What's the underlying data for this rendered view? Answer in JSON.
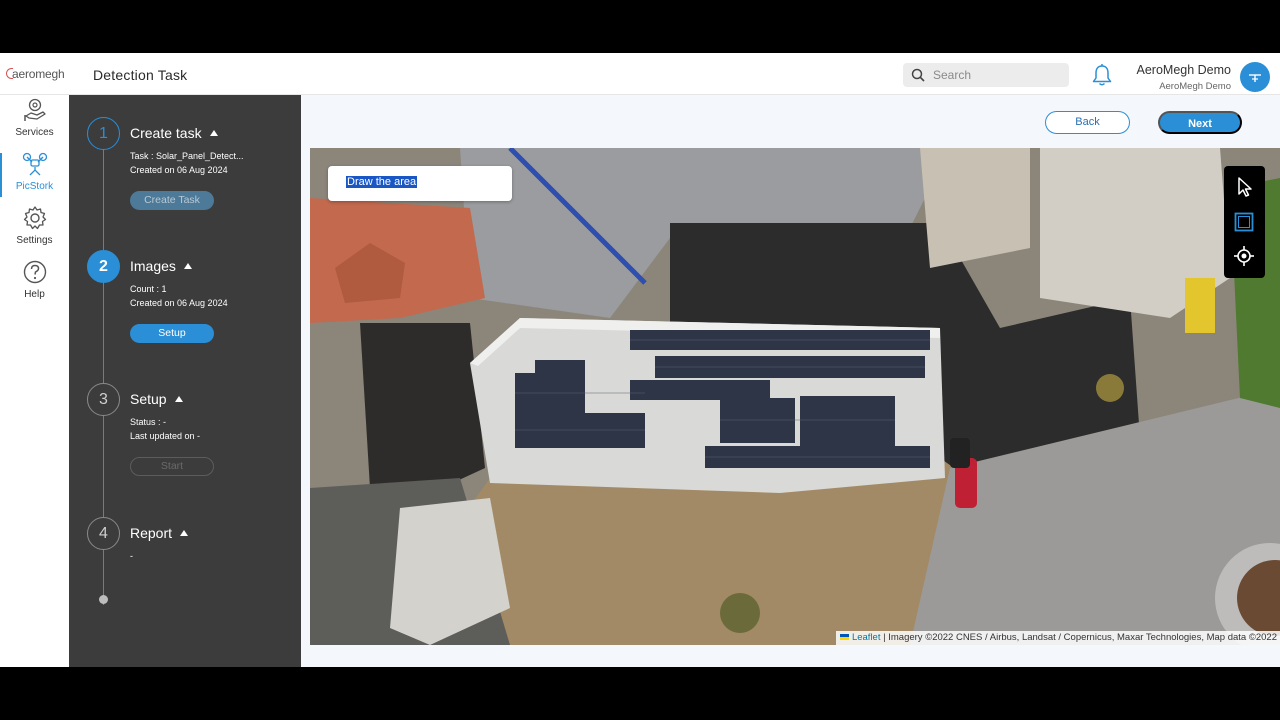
{
  "brand": {
    "logo_text": "aeromegh"
  },
  "header": {
    "title": "Detection Task",
    "search_placeholder": "Search",
    "user_name": "AeroMegh Demo",
    "user_org": "AeroMegh Demo"
  },
  "nav": {
    "items": [
      {
        "label": "Services",
        "icon": "services-icon"
      },
      {
        "label": "PicStork",
        "icon": "drone-icon",
        "active": true
      },
      {
        "label": "Settings",
        "icon": "gear-icon"
      },
      {
        "label": "Help",
        "icon": "help-icon"
      }
    ]
  },
  "steps": [
    {
      "number": "1",
      "title": "Create task",
      "meta1": "Task : Solar_Panel_Detect...",
      "meta2": "Created on 06 Aug 2024",
      "button": "Create Task",
      "state": "done"
    },
    {
      "number": "2",
      "title": "Images",
      "meta1": "Count : 1",
      "meta2": "Created on 06 Aug 2024",
      "button": "Setup",
      "state": "active"
    },
    {
      "number": "3",
      "title": "Setup",
      "meta1": "Status : -",
      "meta2": "Last updated on -",
      "button": "Start",
      "state": "pending"
    },
    {
      "number": "4",
      "title": "Report",
      "meta1": "-",
      "state": "pending"
    }
  ],
  "actions": {
    "back": "Back",
    "next": "Next"
  },
  "map": {
    "draw_prompt": "Draw the area",
    "attribution_link": "Leaflet",
    "attribution_text": "| Imagery ©2022 CNES / Airbus, Landsat / Copernicus, Maxar Technologies, Map data ©2022",
    "tools": [
      "pointer-icon",
      "rectangle-icon",
      "locate-icon"
    ]
  },
  "colors": {
    "accent": "#2a8fd6",
    "sidebar": "#3c3c3c"
  }
}
